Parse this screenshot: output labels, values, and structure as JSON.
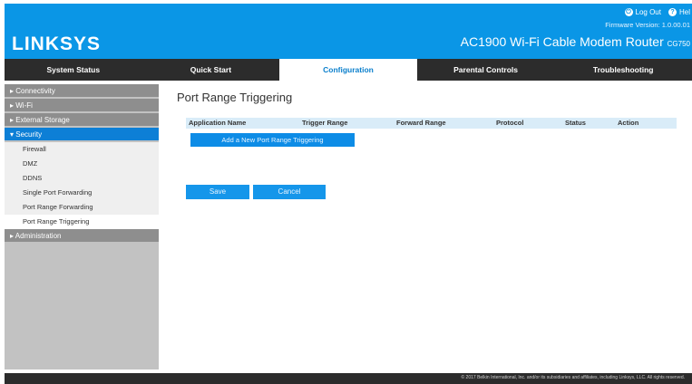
{
  "header": {
    "logo": "LINKSYS",
    "logout_label": "Log Out",
    "help_label": "Hel",
    "firmware_label": "Firmware Version: 1.0.00.01",
    "model": "AC1900 Wi-Fi Cable Modem Router",
    "model_code": "CG750",
    "brand_color": "#0a96e6"
  },
  "nav": {
    "tabs": [
      {
        "label": "System Status"
      },
      {
        "label": "Quick Start"
      },
      {
        "label": "Configuration",
        "active": true
      },
      {
        "label": "Parental Controls"
      },
      {
        "label": "Troubleshooting"
      }
    ]
  },
  "sidebar": {
    "items": [
      {
        "label": "Connectivity"
      },
      {
        "label": "Wi-Fi"
      },
      {
        "label": "External Storage"
      },
      {
        "label": "Security",
        "active": true
      },
      {
        "label": "Administration"
      }
    ],
    "security_sub": [
      {
        "label": "Firewall"
      },
      {
        "label": "DMZ"
      },
      {
        "label": "DDNS"
      },
      {
        "label": "Single Port Forwarding"
      },
      {
        "label": "Port Range Forwarding"
      },
      {
        "label": "Port Range Triggering",
        "active": true
      }
    ]
  },
  "main": {
    "title": "Port Range Triggering",
    "columns": [
      "Application Name",
      "Trigger Range",
      "Forward Range",
      "Protocol",
      "Status",
      "Action"
    ],
    "add_button": "Add a New Port Range Triggering",
    "save_button": "Save",
    "cancel_button": "Cancel"
  },
  "footer": {
    "copyright": "© 2017 Belkin International, Inc. and/or its subsidiaries and affiliates, including Linksys, LLC. All rights reserved."
  }
}
